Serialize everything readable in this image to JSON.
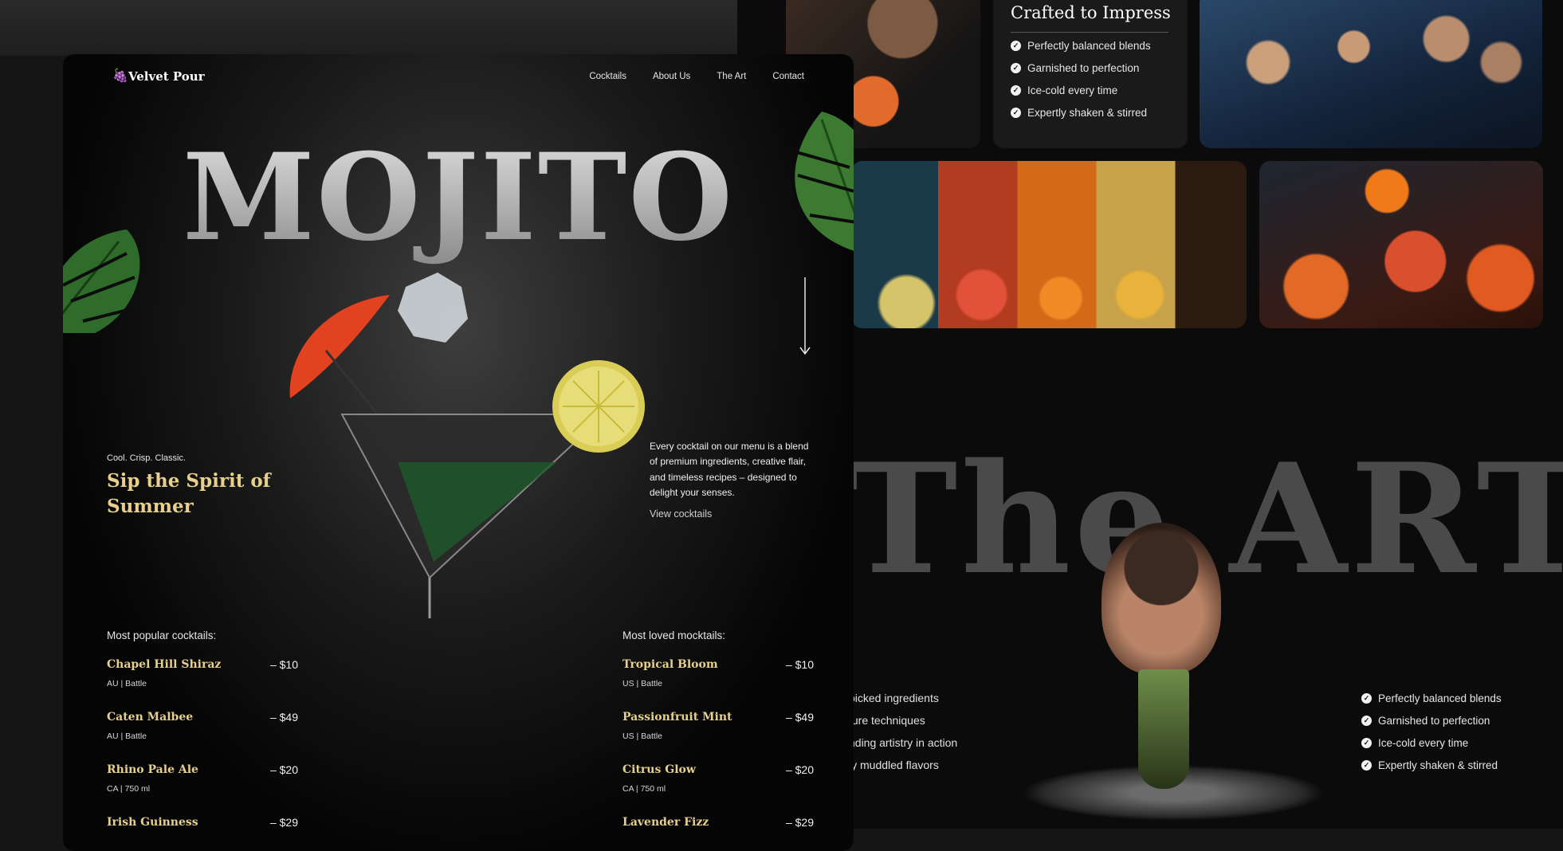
{
  "brand": {
    "name": "Velvet Pour",
    "logo_icon": "cocktail-grapes-icon",
    "accent": "#e7d08c"
  },
  "nav": {
    "links": [
      "Cocktails",
      "About Us",
      "The Art",
      "Contact"
    ]
  },
  "hero": {
    "title": "MOJITO",
    "tagline_small": "Cool. Crisp. Classic.",
    "tagline_big": "Sip the Spirit of Summer",
    "description": "Every cocktail on our menu is a blend of premium ingredients, creative flair, and timeless recipes – designed to delight your senses.",
    "cta": "View cocktails"
  },
  "menus": {
    "cocktails": {
      "heading": "Most popular cocktails:",
      "items": [
        {
          "name": "Chapel Hill Shiraz",
          "price": "– $10",
          "sub": "AU | Battle"
        },
        {
          "name": "Caten Malbee",
          "price": "– $49",
          "sub": "AU | Battle"
        },
        {
          "name": "Rhino Pale Ale",
          "price": "– $20",
          "sub": "CA | 750 ml"
        },
        {
          "name": "Irish Guinness",
          "price": "– $29",
          "sub": ""
        }
      ]
    },
    "mocktails": {
      "heading": "Most loved mocktails:",
      "items": [
        {
          "name": "Tropical Bloom",
          "price": "– $10",
          "sub": "US | Battle"
        },
        {
          "name": "Passionfruit Mint",
          "price": "– $49",
          "sub": "US | Battle"
        },
        {
          "name": "Citrus Glow",
          "price": "– $20",
          "sub": "CA | 750 ml"
        },
        {
          "name": "Lavender Fizz",
          "price": "– $29",
          "sub": ""
        }
      ]
    }
  },
  "crafted": {
    "title": "Crafted to Impress",
    "items": [
      "Perfectly balanced blends",
      "Garnished to perfection",
      "Ice-cold every time",
      "Expertly shaken & stirred"
    ]
  },
  "art": {
    "title": "The ART",
    "left_items": [
      "picked ingredients",
      "ture techniques",
      "nding artistry in action",
      "ly muddled flavors"
    ],
    "right_items": [
      "Perfectly balanced blends",
      "Garnished to perfection",
      "Ice-cold every time",
      "Expertly shaken & stirred"
    ]
  }
}
